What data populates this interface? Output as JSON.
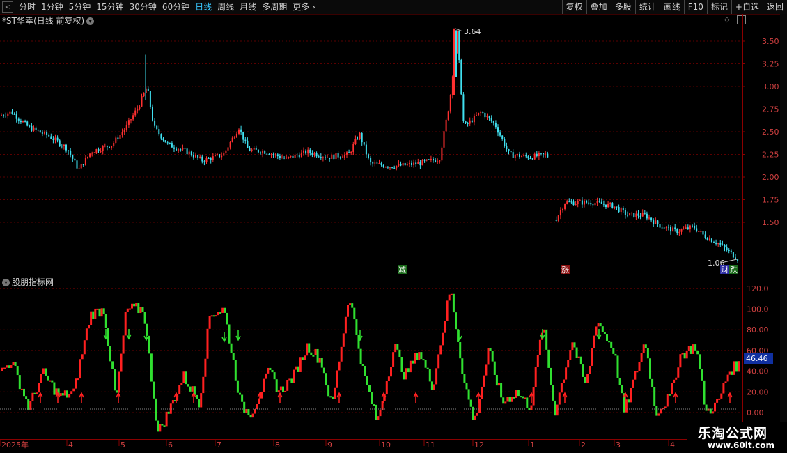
{
  "toolbar": {
    "timeframes": [
      "分时",
      "1分钟",
      "5分钟",
      "15分钟",
      "30分钟",
      "60分钟",
      "日线",
      "周线",
      "月线",
      "多周期",
      "更多"
    ],
    "active": "日线",
    "right_buttons": [
      "复权",
      "叠加",
      "多股",
      "统计",
      "画线",
      "F10",
      "标记",
      "+自选",
      "返回"
    ]
  },
  "price_pane": {
    "title": "*ST华幸(日线 前复权)",
    "y_ticks": [
      "3.50",
      "3.25",
      "3.00",
      "2.75",
      "2.50",
      "2.25",
      "2.00",
      "1.75",
      "1.50"
    ],
    "high_label": "3.64",
    "low_label": "1.06",
    "markers": [
      "减",
      "涨",
      "财",
      "跌"
    ]
  },
  "indicator_pane": {
    "title": "股朋指标网",
    "y_ticks": [
      "120.0",
      "100.0",
      "80.00",
      "60.00",
      "40.00",
      "20.00",
      "0.00"
    ],
    "current_value": "46.46"
  },
  "x_axis": {
    "labels": [
      "2025年",
      "4",
      "5",
      "6",
      "7",
      "8",
      "9",
      "10",
      "11",
      "12",
      "1",
      "2",
      "3",
      "4"
    ]
  },
  "watermark": {
    "title": "乐淘公式网",
    "url": "www.60lt.com"
  },
  "colors": {
    "up": "#ff3030",
    "down": "#40e0f0",
    "ind_up": "#ff2020",
    "ind_down": "#30e030",
    "grid": "#5a0000"
  }
}
